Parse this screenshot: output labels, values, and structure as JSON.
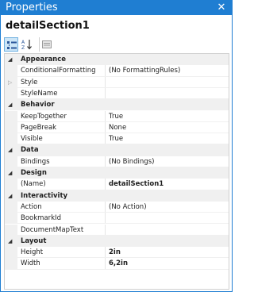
{
  "window": {
    "title": "Properties",
    "close_glyph": "✕",
    "accent": "#1f7ed2"
  },
  "object_name": "detailSection1",
  "toolbar": {
    "buttons": [
      {
        "name": "categorized-view-button",
        "icon": "categorized-icon",
        "active": true
      },
      {
        "name": "alphabetical-view-button",
        "icon": "sort-az-icon",
        "active": false
      },
      {
        "name": "property-pages-button",
        "icon": "property-pages-icon",
        "active": false
      }
    ]
  },
  "grid": {
    "rows": [
      {
        "type": "category",
        "label": "Appearance",
        "expander": "◢"
      },
      {
        "type": "prop",
        "name": "ConditionalFormatting",
        "value": "(No FormattingRules)"
      },
      {
        "type": "prop",
        "name": "Style",
        "value": "",
        "expander": "▷"
      },
      {
        "type": "prop",
        "name": "StyleName",
        "value": ""
      },
      {
        "type": "category",
        "label": "Behavior",
        "expander": "◢"
      },
      {
        "type": "prop",
        "name": "KeepTogether",
        "value": "True"
      },
      {
        "type": "prop",
        "name": "PageBreak",
        "value": "None"
      },
      {
        "type": "prop",
        "name": "Visible",
        "value": "True"
      },
      {
        "type": "category",
        "label": "Data",
        "expander": "◢"
      },
      {
        "type": "prop",
        "name": "Bindings",
        "value": "(No Bindings)"
      },
      {
        "type": "category",
        "label": "Design",
        "expander": "◢"
      },
      {
        "type": "prop",
        "name": "(Name)",
        "value": "detailSection1",
        "bold": true
      },
      {
        "type": "category",
        "label": "Interactivity",
        "expander": "◢"
      },
      {
        "type": "prop",
        "name": "Action",
        "value": "(No Action)"
      },
      {
        "type": "prop",
        "name": "BookmarkId",
        "value": ""
      },
      {
        "type": "prop",
        "name": "DocumentMapText",
        "value": ""
      },
      {
        "type": "category",
        "label": "Layout",
        "expander": "◢"
      },
      {
        "type": "prop",
        "name": "Height",
        "value": "2in",
        "bold": true
      },
      {
        "type": "prop",
        "name": "Width",
        "value": "6,2in",
        "bold": true
      }
    ]
  }
}
